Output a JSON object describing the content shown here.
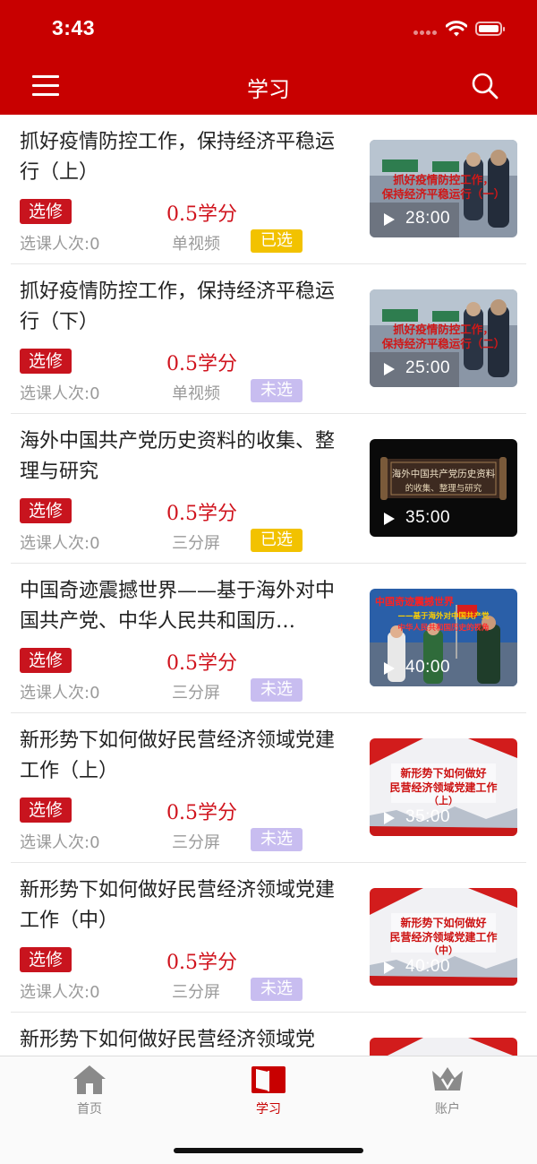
{
  "status_bar": {
    "time": "3:43"
  },
  "header": {
    "title": "学习"
  },
  "courses": [
    {
      "title": "抓好疫情防控工作，保持经济平稳运行（上）",
      "elective": "选修",
      "credit": "0.5学分",
      "enroll": "选课人次:0",
      "video_type": "单视频",
      "status": "已选",
      "status_color": "#f2c200",
      "thumb_caption": [
        "抓好疫情防控工作，",
        "保持经济平稳运行（一）"
      ],
      "duration": "28:00"
    },
    {
      "title": "抓好疫情防控工作，保持经济平稳运行（下）",
      "elective": "选修",
      "credit": "0.5学分",
      "enroll": "选课人次:0",
      "video_type": "单视频",
      "status": "未选",
      "status_color": "#c8bdf0",
      "thumb_caption": [
        "抓好疫情防控工作，",
        "保持经济平稳运行（二）"
      ],
      "duration": "25:00"
    },
    {
      "title": "海外中国共产党历史资料的收集、整理与研究",
      "elective": "选修",
      "credit": "0.5学分",
      "enroll": "选课人次:0",
      "video_type": "三分屏",
      "status": "已选",
      "status_color": "#f2c200",
      "thumb_caption": [
        "海外中国共产党历史资料",
        "的收集、整理与研究"
      ],
      "duration": "35:00"
    },
    {
      "title": "中国奇迹震撼世界——基于海外对中国共产党、中华人民共和国历…",
      "elective": "选修",
      "credit": "0.5学分",
      "enroll": "选课人次:0",
      "video_type": "三分屏",
      "status": "未选",
      "status_color": "#c8bdf0",
      "thumb_caption": [
        "中国奇迹震撼世界",
        "——基于海外对中国共产党",
        "中华人民共和国历史的视角"
      ],
      "duration": "40:00"
    },
    {
      "title": "新形势下如何做好民营经济领域党建工作（上）",
      "elective": "选修",
      "credit": "0.5学分",
      "enroll": "选课人次:0",
      "video_type": "三分屏",
      "status": "未选",
      "status_color": "#c8bdf0",
      "thumb_caption": [
        "新形势下如何做好",
        "民营经济领域党建工作",
        "（上）"
      ],
      "duration": "35:00"
    },
    {
      "title": "新形势下如何做好民营经济领域党建工作（中）",
      "elective": "选修",
      "credit": "0.5学分",
      "enroll": "选课人次:0",
      "video_type": "三分屏",
      "status": "未选",
      "status_color": "#c8bdf0",
      "thumb_caption": [
        "新形势下如何做好",
        "民营经济领域党建工作",
        "（中）"
      ],
      "duration": "40:00"
    },
    {
      "title": "新形势下如何做好民营经济领域党"
    }
  ],
  "tabbar": {
    "home": "首页",
    "study": "学习",
    "account": "账户",
    "active_color": "#c80000",
    "inactive_color": "#8a8a8a"
  },
  "icons": {
    "menu": "menu-icon",
    "search": "search-icon",
    "play": "play-icon",
    "home": "home-icon",
    "study": "book-icon",
    "account": "crown-icon"
  }
}
